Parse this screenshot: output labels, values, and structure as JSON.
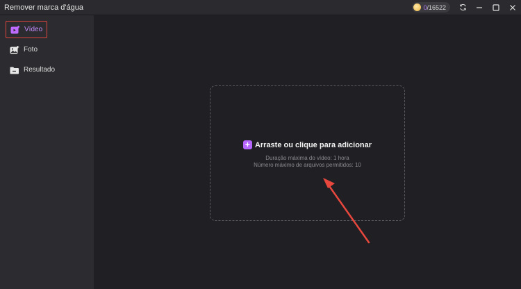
{
  "window": {
    "title": "Remover marca d'água",
    "credits_used": "0",
    "credits_total": "/16522",
    "icons": [
      "coin-icon",
      "refresh-icon",
      "minimize-icon",
      "maximize-icon",
      "close-icon"
    ]
  },
  "sidebar": {
    "items": [
      {
        "label": "Vídeo",
        "icon": "video-add-icon",
        "active": true
      },
      {
        "label": "Foto",
        "icon": "photo-add-icon",
        "active": false
      },
      {
        "label": "Resultado",
        "icon": "folder-icon",
        "active": false
      }
    ]
  },
  "dropzone": {
    "title": "Arraste ou clique para adicionar",
    "line1": "Duração máxima do vídeo: 1 hora",
    "line2": "Número máximo de arquivos permitidos: 10"
  },
  "colors": {
    "accent": "#b566ff",
    "highlight_box": "#e0453d",
    "annotation_arrow": "#e8473e",
    "background": "#202024",
    "sidebar": "#2c2c30"
  }
}
